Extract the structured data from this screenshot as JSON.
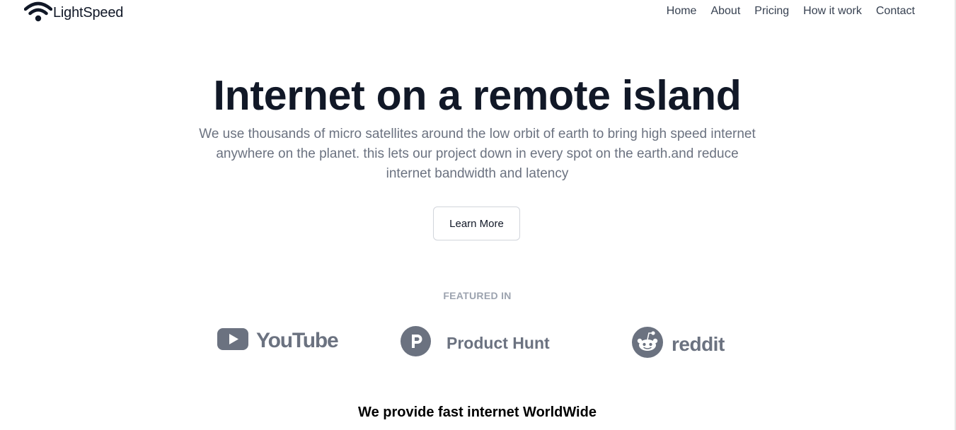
{
  "brand": {
    "name": "LightSpeed",
    "icon": "wifi-icon"
  },
  "nav": {
    "items": [
      "Home",
      "About",
      "Pricing",
      "How it work",
      "Contact"
    ]
  },
  "hero": {
    "title": "Internet on a remote island",
    "subtitle": "We use thousands of micro satellites around the low orbit of earth to bring high speed internet anywhere on the planet. this lets our project down in every spot on the earth.and reduce internet bandwidth and latency",
    "button_label": "Learn More"
  },
  "featured": {
    "label": "FEATURED IN",
    "logos": [
      {
        "name": "YouTube",
        "icon": "youtube-icon"
      },
      {
        "name": "Product Hunt",
        "icon": "product-hunt-icon"
      },
      {
        "name": "reddit",
        "icon": "reddit-icon"
      }
    ]
  },
  "section": {
    "title": "We provide fast internet WorldWide"
  },
  "colors": {
    "heading": "#111827",
    "muted": "#6b7280",
    "logo_gray": "#6b7280",
    "label_gray": "#9ca3af",
    "border": "#d1d5db"
  }
}
